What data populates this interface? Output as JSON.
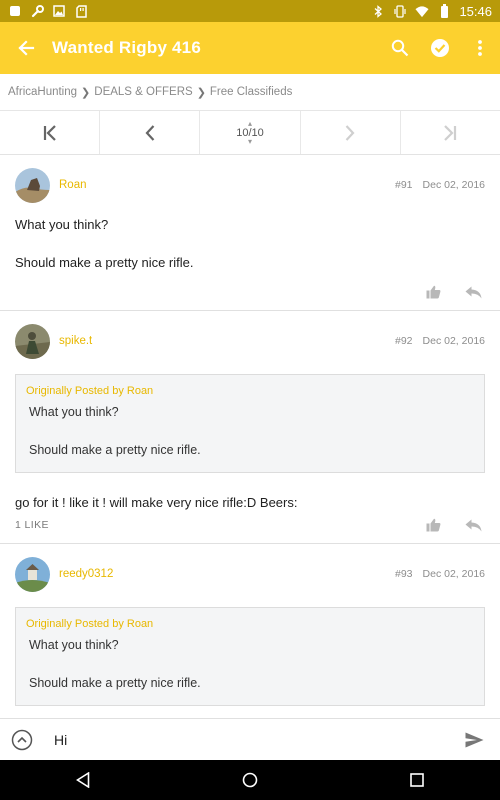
{
  "status_bar": {
    "time": "15:46",
    "left_icons": [
      "square-icon",
      "wrench-icon",
      "image-icon",
      "sd-card-icon"
    ],
    "right_icons": [
      "bluetooth-icon",
      "vibrate-icon",
      "wifi-icon",
      "battery-icon"
    ]
  },
  "app_bar": {
    "title": "Wanted Rigby 416",
    "background": "#fcd12f",
    "actions": [
      "search-icon",
      "check-circle-icon",
      "more-vert-icon"
    ]
  },
  "breadcrumb": {
    "items": [
      "AfricaHunting",
      "DEALS & OFFERS",
      "Free Classifieds"
    ]
  },
  "pager": {
    "current": "10/10"
  },
  "posts": [
    {
      "username": "Roan",
      "number": "#91",
      "date": "Dec 02, 2016",
      "body": [
        "What you think?",
        "Should make a pretty nice rifle."
      ]
    },
    {
      "username": "spike.t",
      "number": "#92",
      "date": "Dec 02, 2016",
      "quote": {
        "author": "Originally Posted by Roan",
        "lines": [
          "What you think?",
          "Should make a pretty nice rifle."
        ]
      },
      "body": [
        "go for it ! like it ! will make very nice rifle:D Beers:"
      ],
      "likes": "1 LIKE"
    },
    {
      "username": "reedy0312",
      "number": "#93",
      "date": "Dec 02, 2016",
      "quote": {
        "author": "Originally Posted by Roan",
        "lines": [
          "What you think?",
          "Should make a pretty nice rifle."
        ]
      }
    }
  ],
  "composer": {
    "value": "Hi"
  },
  "colors": {
    "accent": "#fcd12f",
    "username": "#e8b800",
    "status_bar": "#b89a0a"
  }
}
